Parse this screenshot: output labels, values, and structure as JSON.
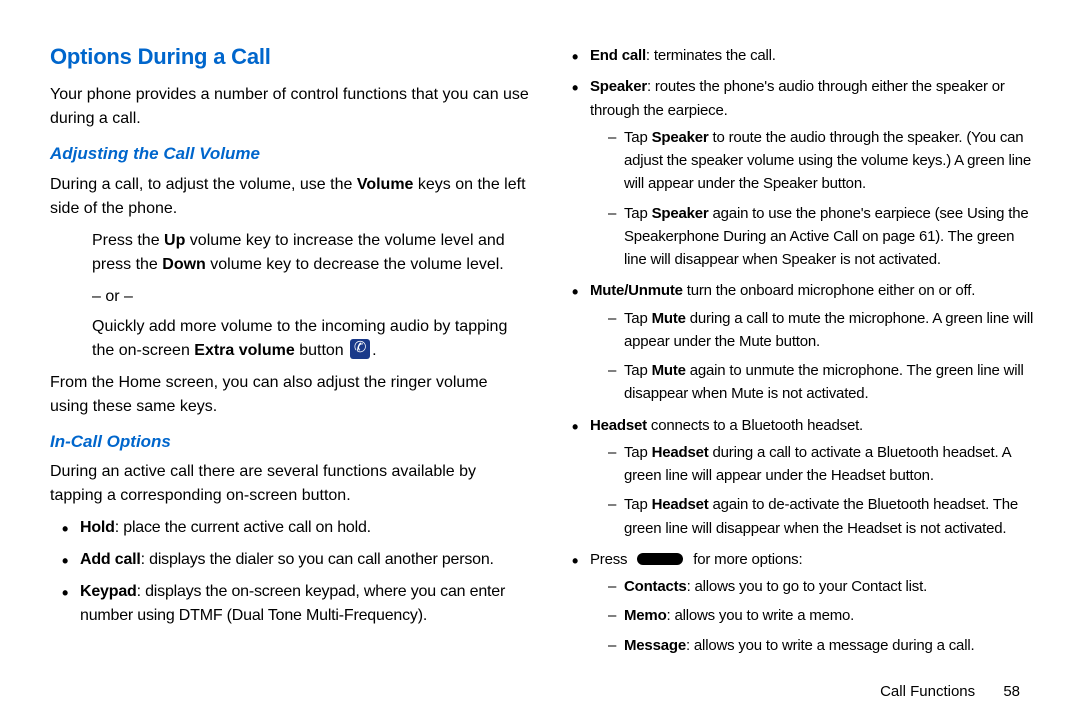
{
  "left": {
    "h1": "Options During a Call",
    "intro": "Your phone provides a number of control functions that you can use during a call.",
    "h2a": "Adjusting the Call Volume",
    "adj1_pre": "During a call, to adjust the volume, use the ",
    "adj1_b": "Volume",
    "adj1_post": " keys on the left side of the phone.",
    "press_pre": "Press the ",
    "press_up": "Up",
    "press_mid": " volume key to increase the volume level and press the ",
    "press_dn": "Down",
    "press_post": " volume key to decrease the volume level.",
    "or": "– or –",
    "quick_pre": "Quickly add more volume to the incoming audio by tapping the on-screen ",
    "quick_b": "Extra volume",
    "quick_post1": " button ",
    "quick_post2": ".",
    "from_home": "From the Home screen, you can also adjust the ringer volume using these same keys.",
    "h2b": "In-Call Options",
    "incall_p": "During an active call there are several functions available by tapping a corresponding on-screen button.",
    "hold_b": "Hold",
    "hold_t": ": place the current active call on hold.",
    "add_b": "Add call",
    "add_t": ": displays the dialer so you can call another person.",
    "key_b": "Keypad",
    "key_t": ": displays the on-screen keypad, where you can enter number using DTMF (Dual Tone Multi-Frequency)."
  },
  "right": {
    "end_b": "End call",
    "end_t": ": terminates the call.",
    "spk_b": "Speaker",
    "spk_t": ": routes the phone's audio through either the speaker or through the earpiece.",
    "spk_d1_pre": "Tap ",
    "spk_d1_b": "Speaker",
    "spk_d1_post": " to route the audio through the speaker. (You can adjust the speaker volume using the volume keys.) A green line will appear under the Speaker button.",
    "spk_d2_pre": "Tap ",
    "spk_d2_b": "Speaker",
    "spk_d2_mid": " again to use the phone's earpiece (see ",
    "spk_d2_ref": "Using the Speakerphone During an Active Call",
    "spk_d2_pg": " on page 61). The green line will disappear when Speaker is not activated.",
    "mute_b": "Mute/Unmute",
    "mute_t": " turn the onboard microphone either on or off.",
    "mute_d1_pre": "Tap ",
    "mute_d1_b": "Mute",
    "mute_d1_post": " during a call to mute the microphone. A green line will appear under the Mute button.",
    "mute_d2_pre": "Tap ",
    "mute_d2_b": "Mute",
    "mute_d2_post": " again to unmute the microphone. The green line will disappear when Mute is not activated.",
    "hs_b": "Headset",
    "hs_t": " connects to a Bluetooth headset.",
    "hs_d1_pre": "Tap ",
    "hs_d1_b": "Headset",
    "hs_d1_post": " during a call to activate a Bluetooth headset. A green line will appear under the Headset button.",
    "hs_d2_pre": "Tap ",
    "hs_d2_b": "Headset",
    "hs_d2_post": " again to de-activate the Bluetooth headset. The green line will disappear when the Headset is not activated.",
    "press_pre": "Press ",
    "press_post": " for more options:",
    "con_b": "Contacts",
    "con_t": ": allows you to go to your Contact list.",
    "memo_b": "Memo",
    "memo_t": ": allows you to write a memo.",
    "msg_b": "Message",
    "msg_t": ": allows you to write a message during a call."
  },
  "footer": {
    "section": "Call Functions",
    "page": "58"
  }
}
